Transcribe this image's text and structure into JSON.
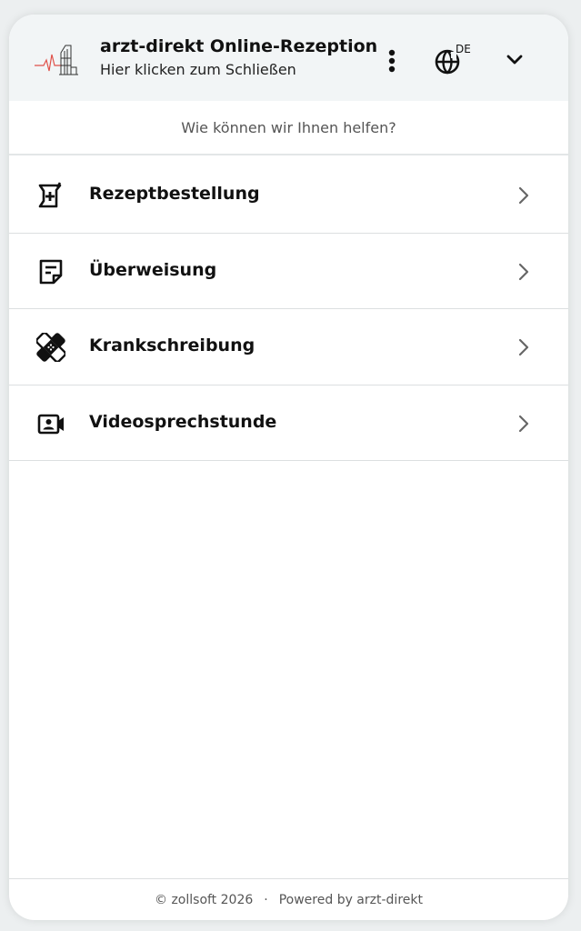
{
  "header": {
    "title": "arzt-direkt Online-Rezeption",
    "subtitle": "Hier klicken zum Schließen",
    "language": "DE",
    "icons": {
      "logo": "pulse-building-logo",
      "menu": "more-vert-icon",
      "language": "globe-icon",
      "collapse": "chevron-down-icon"
    }
  },
  "question": "Wie können wir Ihnen helfen?",
  "options": [
    {
      "label": "Rezeptbestellung",
      "icon": "prescription-icon"
    },
    {
      "label": "Überweisung",
      "icon": "sticky-note-icon"
    },
    {
      "label": "Krankschreibung",
      "icon": "bandage-icon"
    },
    {
      "label": "Videosprechstunde",
      "icon": "video-contact-icon"
    }
  ],
  "footer": {
    "copyright": "© zollsoft 2026",
    "separator": "·",
    "powered_by": "Powered by arzt-direkt"
  },
  "colors": {
    "accent_red": "#e0524a",
    "header_bg": "#f2f5f6",
    "background": "#eceff0"
  }
}
